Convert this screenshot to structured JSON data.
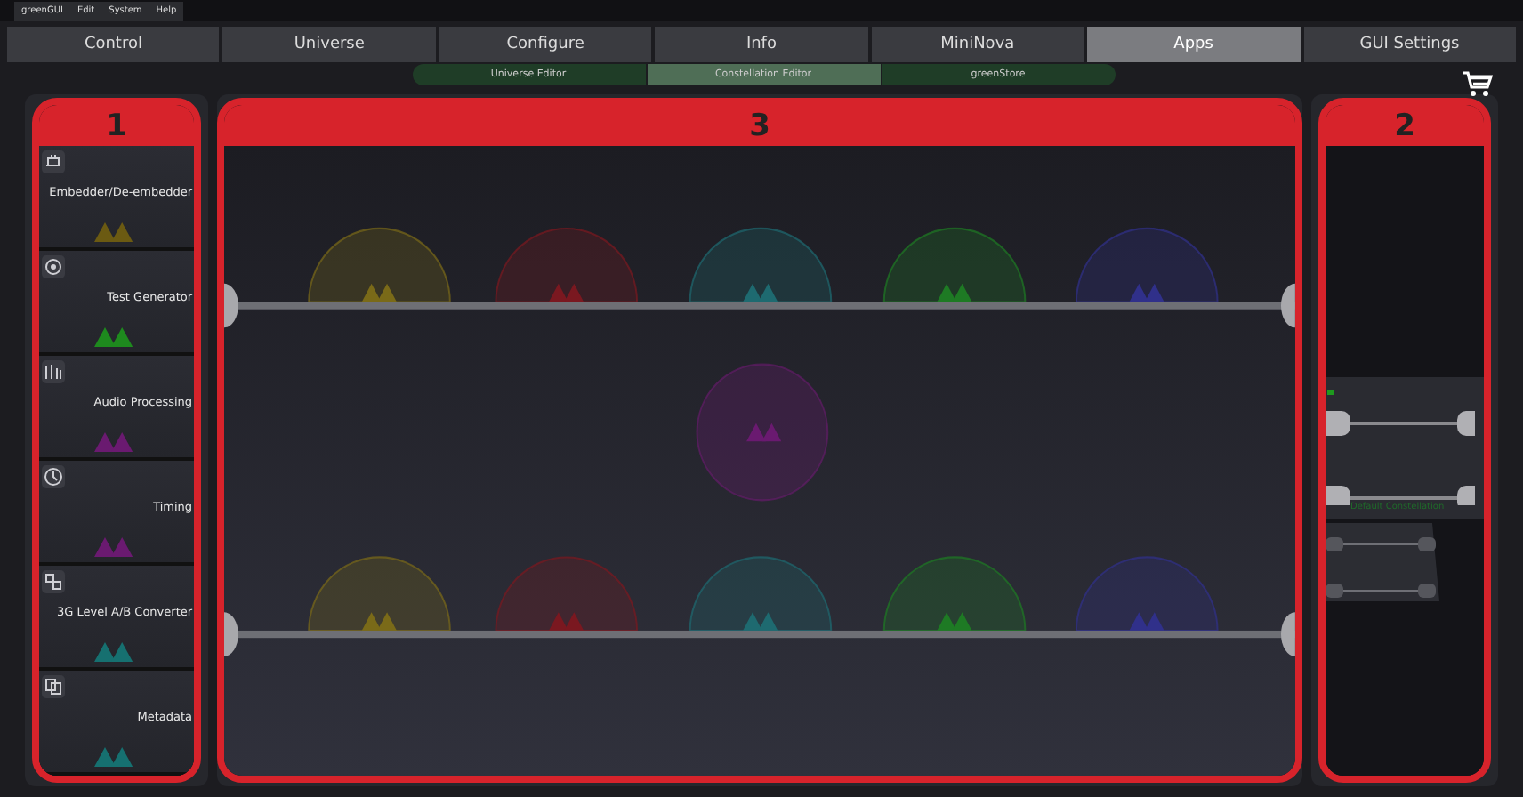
{
  "menu_bar": [
    "greenGUI",
    "Edit",
    "System",
    "Help"
  ],
  "tabs": [
    {
      "label": "Control",
      "selected": false
    },
    {
      "label": "Universe",
      "selected": false
    },
    {
      "label": "Configure",
      "selected": false
    },
    {
      "label": "Info",
      "selected": false
    },
    {
      "label": "MiniNova",
      "selected": false
    },
    {
      "label": "Apps",
      "selected": true
    },
    {
      "label": "GUI Settings",
      "selected": false
    }
  ],
  "subtabs": [
    {
      "label": "Universe Editor",
      "selected": false
    },
    {
      "label": "Constellation Editor",
      "selected": true
    },
    {
      "label": "greenStore",
      "selected": false
    }
  ],
  "palette": {
    "badge": "1",
    "items": [
      {
        "label": "Embedder/De-embedder",
        "color": "#6b5a12"
      },
      {
        "label": "Test Generator",
        "color": "#1e8a1e"
      },
      {
        "label": "Audio Processing",
        "color": "#6a1a70"
      },
      {
        "label": "Timing",
        "color": "#6a1a70"
      },
      {
        "label": "3G Level A/B Converter",
        "color": "#167070"
      },
      {
        "label": "Metadata",
        "color": "#167070"
      }
    ]
  },
  "canvas": {
    "badge": "3",
    "shelves": [
      {
        "apps": [
          {
            "color": "#7a6a18"
          },
          {
            "color": "#7a1820"
          },
          {
            "color": "#1e6a70"
          },
          {
            "color": "#1e7a24"
          },
          {
            "color": "#30308a"
          }
        ]
      },
      {
        "apps": [
          {
            "color": "#7a6a18"
          },
          {
            "color": "#7a1820"
          },
          {
            "color": "#1e6a70"
          },
          {
            "color": "#1e7a24"
          },
          {
            "color": "#30308a"
          }
        ]
      }
    ],
    "floating": {
      "color": "#6a1a70"
    }
  },
  "overview": {
    "badge": "2",
    "caption": "Default Constellation"
  }
}
